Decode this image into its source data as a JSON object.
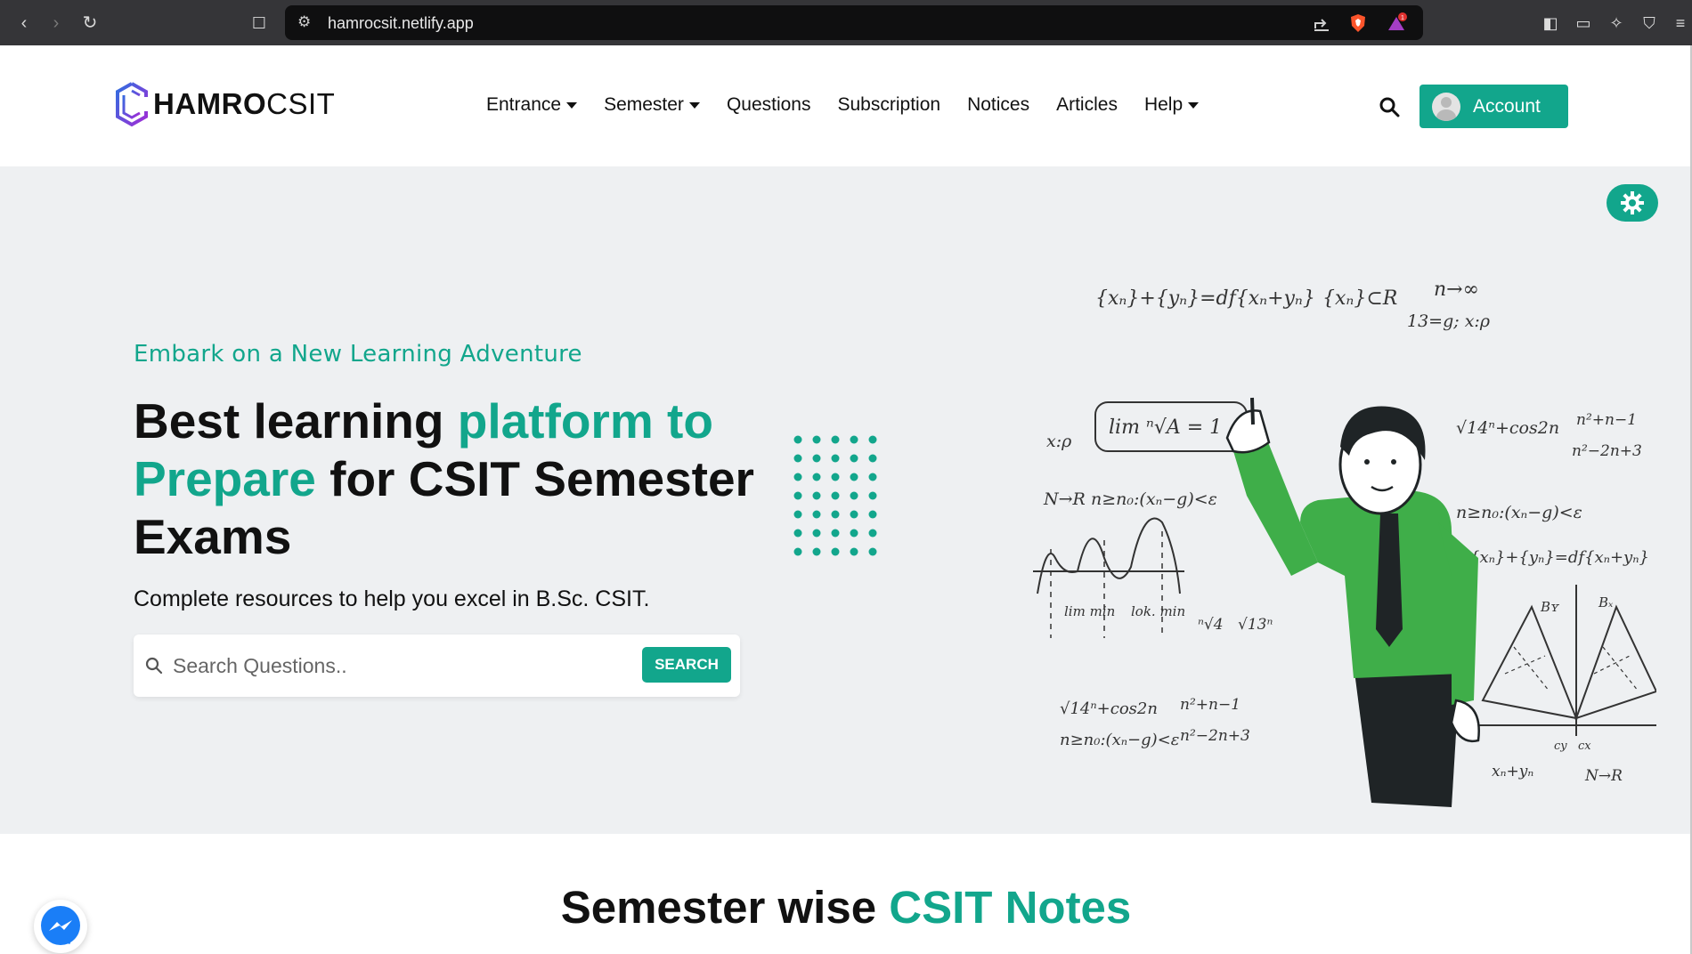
{
  "browser": {
    "url": "hamrocsit.netlify.app",
    "shield_badge": "1"
  },
  "brand": {
    "logo_bold": "HAMRO",
    "logo_regular": "CSIT"
  },
  "nav": {
    "items": [
      {
        "label": "Entrance",
        "dropdown": true
      },
      {
        "label": "Semester",
        "dropdown": true
      },
      {
        "label": "Questions",
        "dropdown": false
      },
      {
        "label": "Subscription",
        "dropdown": false
      },
      {
        "label": "Notices",
        "dropdown": false
      },
      {
        "label": "Articles",
        "dropdown": false
      },
      {
        "label": "Help",
        "dropdown": true
      }
    ],
    "account_label": "Account"
  },
  "hero": {
    "tagline": "Embark on a New Learning Adventure",
    "headline_part1": "Best learning ",
    "headline_accent": "platform to Prepare",
    "headline_part2": " for CSIT Semester Exams",
    "subline": "Complete resources to help you excel in B.Sc. CSIT.",
    "search_placeholder": "Search Questions..",
    "search_button": "SEARCH"
  },
  "section": {
    "title_part1": "Semester wise ",
    "title_accent": "CSIT Notes"
  },
  "colors": {
    "accent": "#12a68c",
    "hero_bg": "#eef0f2",
    "text": "#111111"
  },
  "illustration": {
    "formulas": [
      "{xₙ}+{yₙ}=df{xₙ+yₙ}",
      "{xₙ}⊂R",
      "n→∞",
      "13=g; x:ρ",
      "lim ⁿ√A = 1",
      "x:ρ",
      "N→R",
      "n≥n₀:(xₙ−g)<ε",
      "√14ⁿ+cos2n",
      "n²+n−1",
      "n²−2n+3",
      "lim min",
      "lok. min",
      "ⁿ√4",
      "√13ⁿ",
      "Bʏ",
      "Bₓ",
      "xₙ+yₙ",
      "N→R",
      "cy",
      "cx"
    ]
  }
}
